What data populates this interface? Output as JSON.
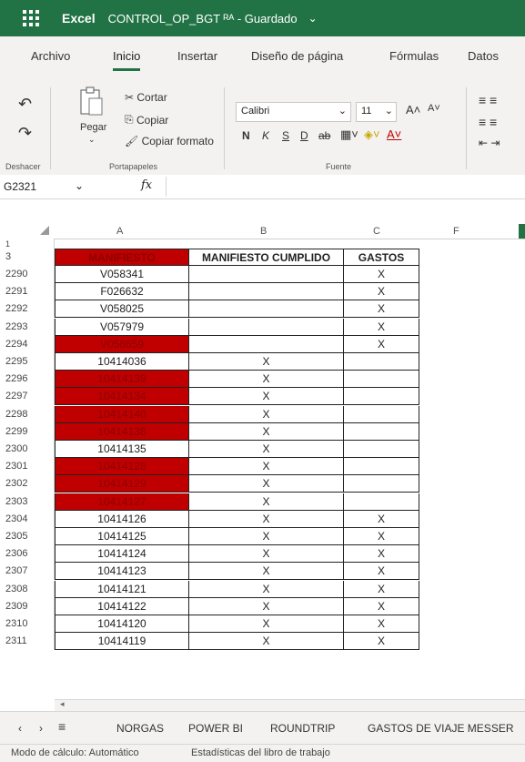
{
  "titlebar": {
    "app": "Excel",
    "document": "CONTROL_OP_BGT ᴿᴬ - Guardado",
    "chevron": "⌄"
  },
  "menu": {
    "tabs": [
      "Archivo",
      "Inicio",
      "Insertar",
      "Diseño de página",
      "Fórmulas",
      "Datos"
    ],
    "active": "Inicio"
  },
  "ribbon": {
    "undo_group": "Deshacer",
    "clipboard": {
      "paste": "Pegar",
      "cut": "Cortar",
      "copy": "Copiar",
      "format_painter": "Copiar formato",
      "label": "Portapapeles"
    },
    "font": {
      "name": "Calibri",
      "size": "11",
      "label": "Fuente",
      "bold": "N",
      "italic": "K",
      "underline": "S",
      "double_underline": "D",
      "strike": "ab",
      "grow": "A˄",
      "shrink": "A˅"
    }
  },
  "formula": {
    "name_box": "G2321",
    "fx": "fx",
    "value": ""
  },
  "columns": [
    "A",
    "B",
    "C",
    "F"
  ],
  "header_row": {
    "num": "3",
    "manifiesto": "MANIFIESTO",
    "cumplido": "MANIFIESTO CUMPLIDO",
    "gastos": "GASTOS"
  },
  "rows": [
    {
      "num": "2290",
      "a": "V058341",
      "b": "",
      "c": "X",
      "red": false
    },
    {
      "num": "2291",
      "a": "F026632",
      "b": "",
      "c": "X",
      "red": false
    },
    {
      "num": "2292",
      "a": "V058025",
      "b": "",
      "c": "X",
      "red": false
    },
    {
      "num": "2293",
      "a": "V057979",
      "b": "",
      "c": "X",
      "red": false
    },
    {
      "num": "2294",
      "a": "V058659",
      "b": "",
      "c": "X",
      "red": true
    },
    {
      "num": "2295",
      "a": "10414036",
      "b": "X",
      "c": "",
      "red": false
    },
    {
      "num": "2296",
      "a": "10414139",
      "b": "X",
      "c": "",
      "red": true
    },
    {
      "num": "2297",
      "a": "10414134",
      "b": "X",
      "c": "",
      "red": true
    },
    {
      "num": "2298",
      "a": "10414140",
      "b": "X",
      "c": "",
      "red": true
    },
    {
      "num": "2299",
      "a": "10414138",
      "b": "X",
      "c": "",
      "red": true
    },
    {
      "num": "2300",
      "a": "10414135",
      "b": "X",
      "c": "",
      "red": false
    },
    {
      "num": "2301",
      "a": "10414128",
      "b": "X",
      "c": "",
      "red": true
    },
    {
      "num": "2302",
      "a": "10414129",
      "b": "X",
      "c": "",
      "red": true
    },
    {
      "num": "2303",
      "a": "10414127",
      "b": "X",
      "c": "",
      "red": true
    },
    {
      "num": "2304",
      "a": "10414126",
      "b": "X",
      "c": "X",
      "red": false
    },
    {
      "num": "2305",
      "a": "10414125",
      "b": "X",
      "c": "X",
      "red": false
    },
    {
      "num": "2306",
      "a": "10414124",
      "b": "X",
      "c": "X",
      "red": false
    },
    {
      "num": "2307",
      "a": "10414123",
      "b": "X",
      "c": "X",
      "red": false
    },
    {
      "num": "2308",
      "a": "10414121",
      "b": "X",
      "c": "X",
      "red": false
    },
    {
      "num": "2309",
      "a": "10414122",
      "b": "X",
      "c": "X",
      "red": false
    },
    {
      "num": "2310",
      "a": "10414120",
      "b": "X",
      "c": "X",
      "red": false
    },
    {
      "num": "2311",
      "a": "10414119",
      "b": "X",
      "c": "X",
      "red": false
    }
  ],
  "sheets": [
    "NORGAS",
    "POWER BI",
    "ROUNDTRIP",
    "GASTOS DE VIAJE MESSER"
  ],
  "status": {
    "calc": "Modo de cálculo: Automático",
    "stats": "Estadísticas del libro de trabajo"
  },
  "colors": {
    "excel_green": "#217346",
    "highlight_red": "#c00000"
  }
}
